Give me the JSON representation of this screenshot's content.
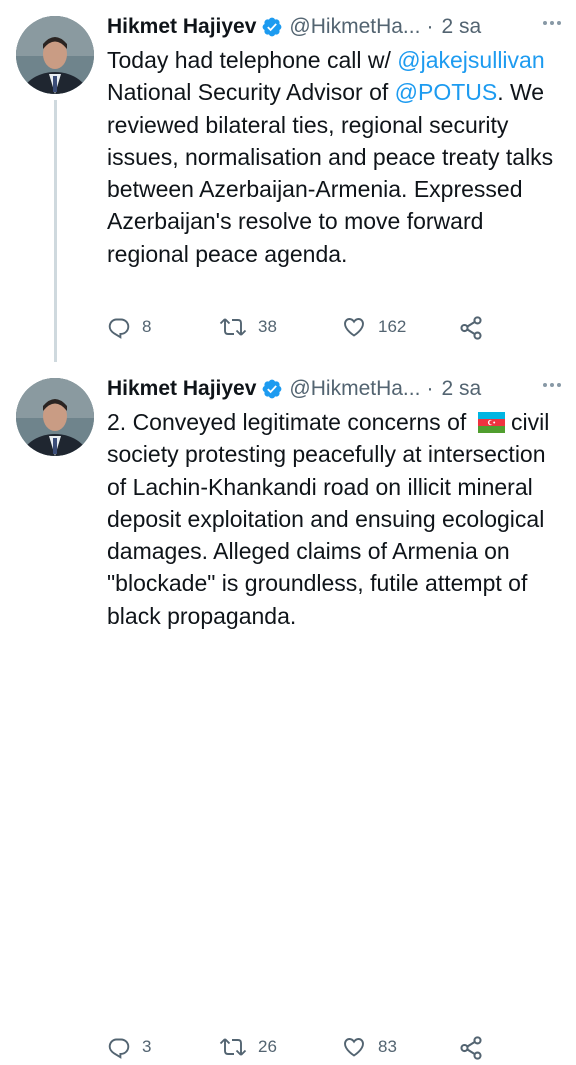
{
  "tweets": [
    {
      "author": {
        "name": "Hikmet Hajiyev",
        "handle": "@HikmetHa...",
        "separator": "·",
        "time": "2 sa"
      },
      "text": {
        "part1": "Today had telephone call w/ ",
        "mention1": "@jakejsullivan",
        "part2": " National Security Advisor of ",
        "mention2": "@POTUS",
        "part3": ". We reviewed bilateral ties, regional security issues, normalisation and peace treaty talks between Azerbaijan-Armenia. Expressed Azerbaijan's resolve to move forward regional peace agenda."
      },
      "actions": {
        "replies": "8",
        "retweets": "38",
        "likes": "162"
      }
    },
    {
      "author": {
        "name": "Hikmet Hajiyev",
        "handle": "@HikmetHa...",
        "separator": "·",
        "time": "2 sa"
      },
      "text": {
        "part1": "2. Conveyed legitimate concerns of ",
        "part2": " civil society protesting peacefully at intersection of Lachin-Khankandi road on illicit mineral deposit exploitation and ensuing ecological damages. Alleged claims of Armenia on \"blockade\" is groundless, futile attempt of black propaganda."
      },
      "actions": {
        "replies": "3",
        "retweets": "26",
        "likes": "83"
      }
    }
  ],
  "icons": {
    "verified": "verified-badge-icon",
    "reply": "reply-icon",
    "retweet": "retweet-icon",
    "like": "heart-icon",
    "share": "share-icon",
    "more": "more-icon",
    "flag": "azerbaijan-flag-icon"
  },
  "colors": {
    "accent": "#1d9bf0",
    "muted": "#536471",
    "text": "#0f1419",
    "thread_line": "#cfd9de"
  }
}
